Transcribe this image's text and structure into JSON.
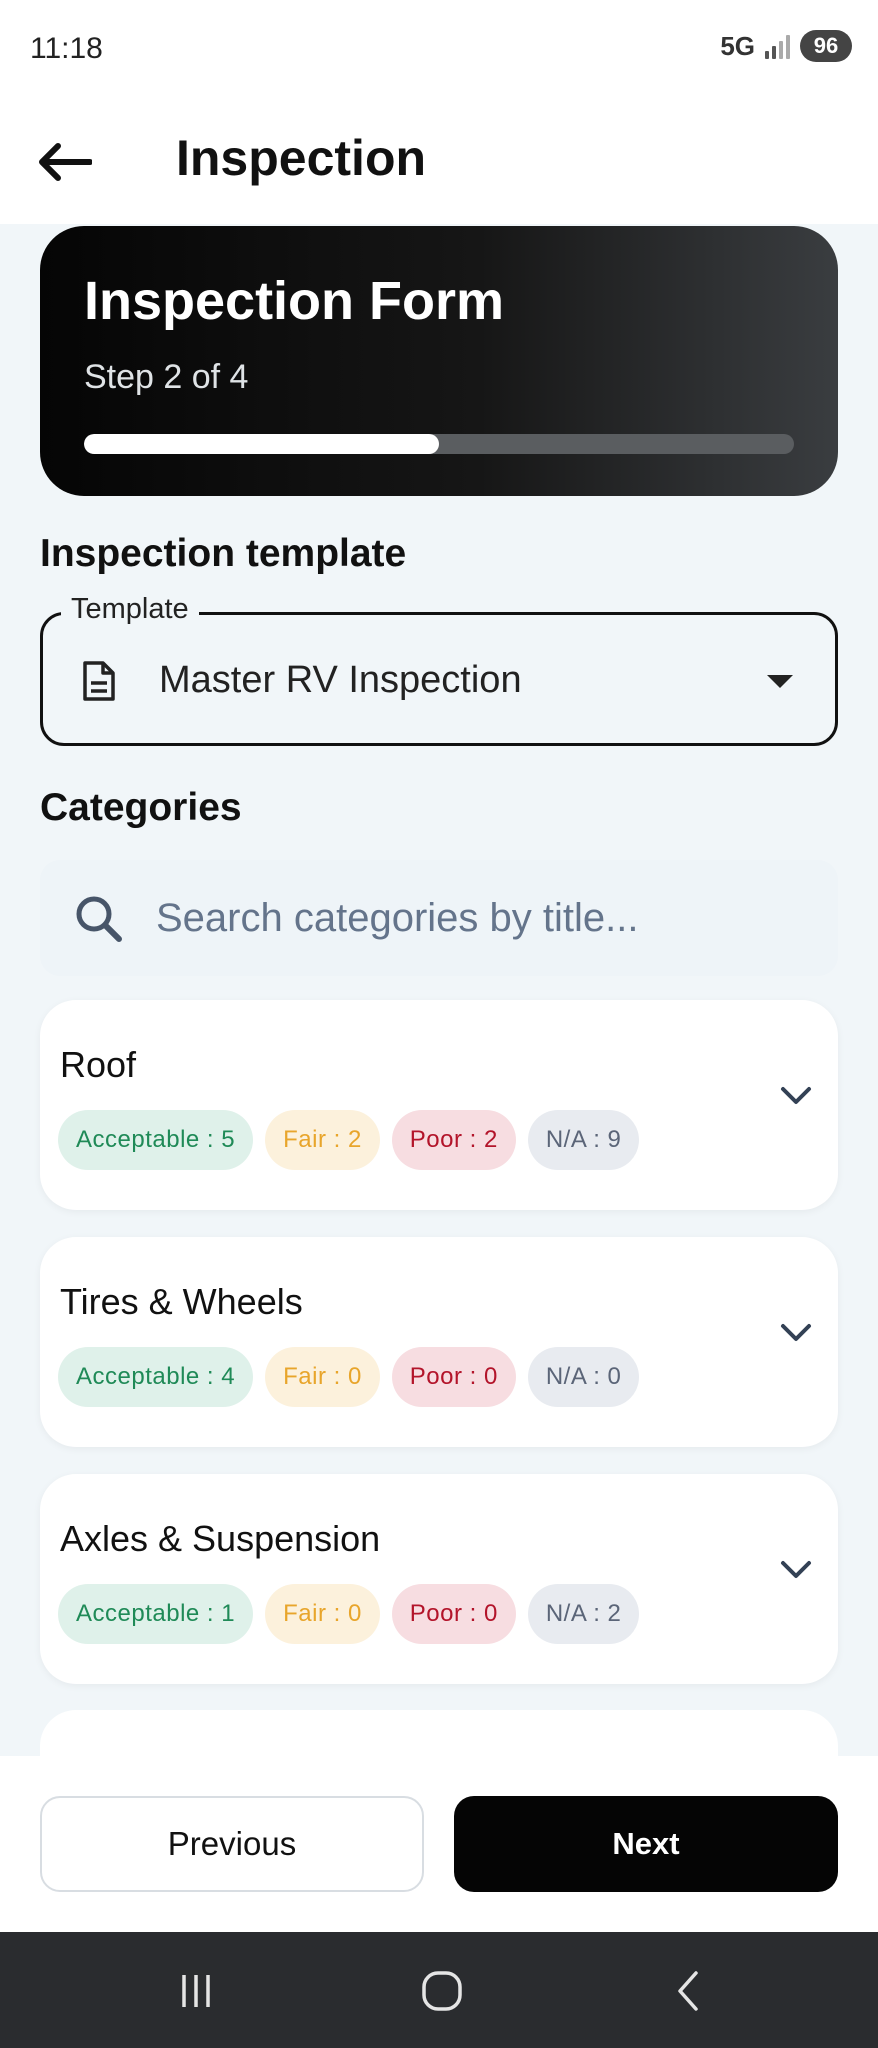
{
  "status_bar": {
    "time": "11:18",
    "network": "5G",
    "battery": "96"
  },
  "app_bar": {
    "title": "Inspection",
    "back_icon": "arrow-left-icon"
  },
  "hero": {
    "title": "Inspection Form",
    "subtitle": "Step 2 of 4",
    "progress_fraction": 0.5
  },
  "template_section": {
    "heading": "Inspection template",
    "field_label": "Template",
    "value": "Master RV Inspection",
    "icon": "document-icon"
  },
  "categories_section": {
    "heading": "Categories",
    "search_placeholder": "Search categories by title...",
    "items": [
      {
        "title": "Roof",
        "acceptable": "Acceptable : 5",
        "fair": "Fair : 2",
        "poor": "Poor : 2",
        "na": "N/A : 9"
      },
      {
        "title": "Tires & Wheels",
        "acceptable": "Acceptable : 4",
        "fair": "Fair : 0",
        "poor": "Poor : 0",
        "na": "N/A : 0"
      },
      {
        "title": "Axles & Suspension",
        "acceptable": "Acceptable : 1",
        "fair": "Fair : 0",
        "poor": "Poor : 0",
        "na": "N/A : 2"
      }
    ]
  },
  "footer": {
    "previous_label": "Previous",
    "next_label": "Next"
  },
  "colors": {
    "accent_dark": "#050505",
    "acceptable": "#1f8a57",
    "fair": "#e8a52b",
    "poor": "#b3142a",
    "na": "#5b6578"
  }
}
